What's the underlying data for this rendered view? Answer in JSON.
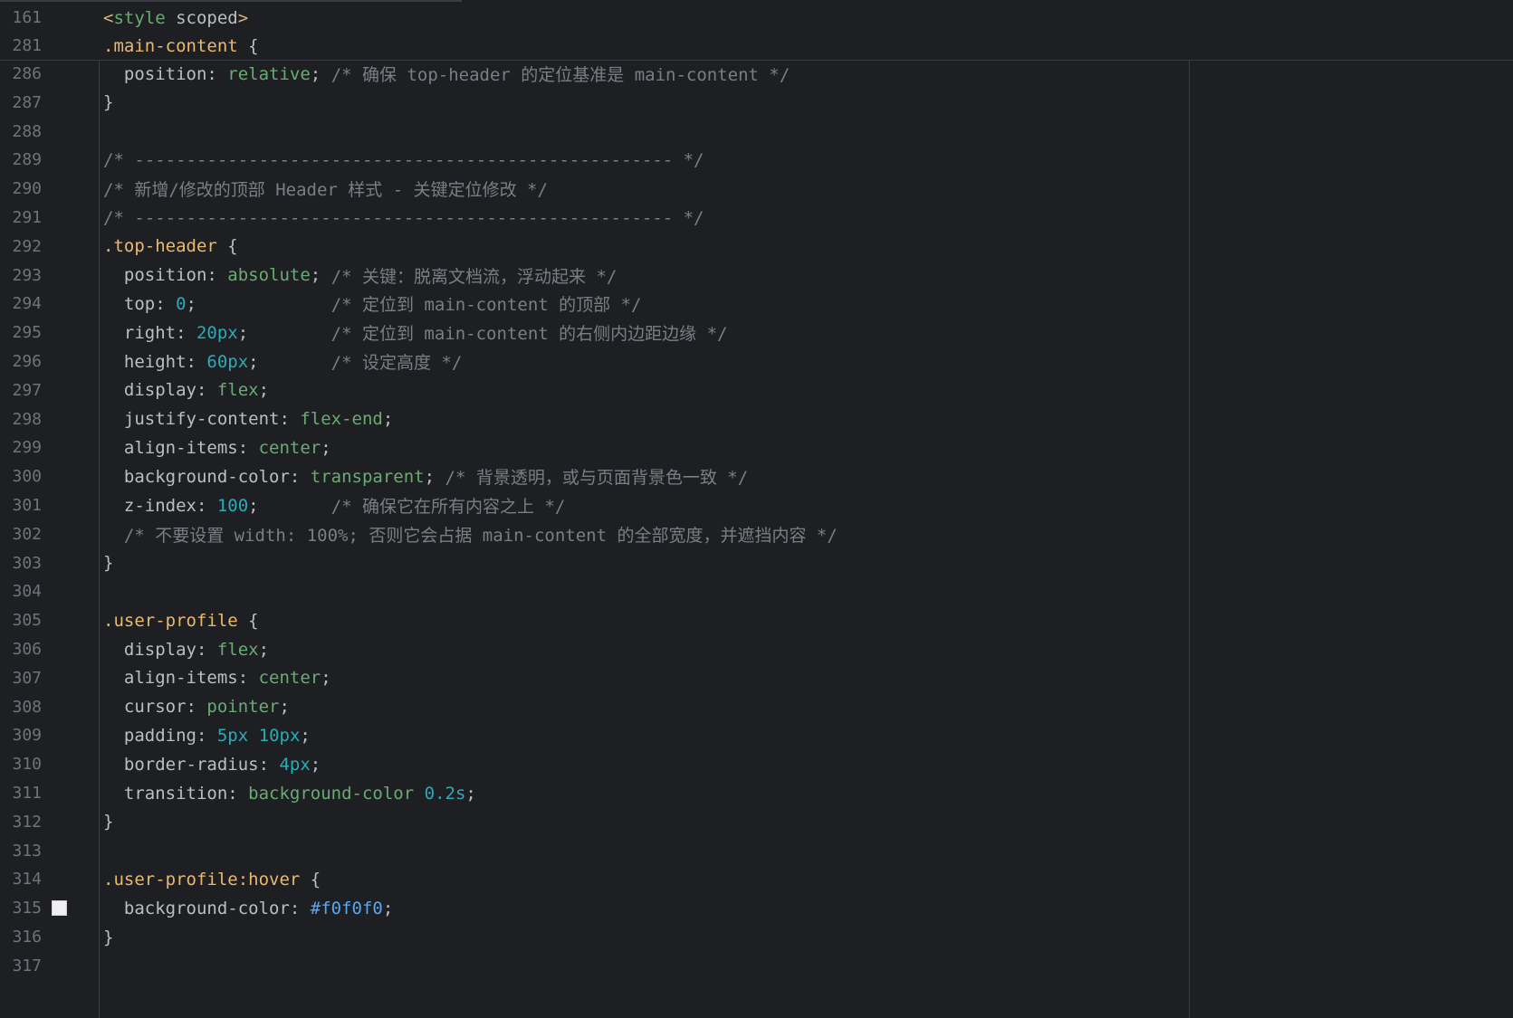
{
  "editor": {
    "language": "css",
    "colors": {
      "background": "#1e1f22",
      "line_number": "#6f737a",
      "property": "#bcbec4",
      "selector": "#e8ba71",
      "value_keyword": "#6aab73",
      "number": "#2aacb8",
      "comment": "#7a7e85",
      "hex_color": "#56a8f5"
    },
    "sticky_lines": [
      {
        "num": "161",
        "tokens": [
          {
            "t": "tag",
            "v": "<"
          },
          {
            "t": "tagname",
            "v": "style"
          },
          {
            "t": "plain",
            "v": " scoped"
          },
          {
            "t": "tag",
            "v": ">"
          }
        ]
      },
      {
        "num": "281",
        "tokens": [
          {
            "t": "sel",
            "v": ".main-content"
          },
          {
            "t": "plain",
            "v": " {"
          }
        ]
      }
    ],
    "lines": [
      {
        "num": "286",
        "tokens": [
          {
            "t": "plain",
            "v": "  position: "
          },
          {
            "t": "kw",
            "v": "relative"
          },
          {
            "t": "plain",
            "v": "; "
          },
          {
            "t": "com",
            "v": "/* 确保 top-header 的定位基准是 main-content */"
          }
        ]
      },
      {
        "num": "287",
        "tokens": [
          {
            "t": "plain",
            "v": "}"
          }
        ]
      },
      {
        "num": "288",
        "tokens": []
      },
      {
        "num": "289",
        "tokens": [
          {
            "t": "com",
            "v": "/* ---------------------------------------------------- */"
          }
        ]
      },
      {
        "num": "290",
        "tokens": [
          {
            "t": "com",
            "v": "/* 新增/修改的顶部 Header 样式 - 关键定位修改 */"
          }
        ]
      },
      {
        "num": "291",
        "tokens": [
          {
            "t": "com",
            "v": "/* ---------------------------------------------------- */"
          }
        ]
      },
      {
        "num": "292",
        "tokens": [
          {
            "t": "sel",
            "v": ".top-header"
          },
          {
            "t": "plain",
            "v": " {"
          }
        ]
      },
      {
        "num": "293",
        "tokens": [
          {
            "t": "plain",
            "v": "  position: "
          },
          {
            "t": "kw",
            "v": "absolute"
          },
          {
            "t": "plain",
            "v": "; "
          },
          {
            "t": "com",
            "v": "/* 关键：脱离文档流，浮动起来 */"
          }
        ]
      },
      {
        "num": "294",
        "tokens": [
          {
            "t": "plain",
            "v": "  top: "
          },
          {
            "t": "num",
            "v": "0"
          },
          {
            "t": "plain",
            "v": ";             "
          },
          {
            "t": "com",
            "v": "/* 定位到 main-content 的顶部 */"
          }
        ]
      },
      {
        "num": "295",
        "tokens": [
          {
            "t": "plain",
            "v": "  right: "
          },
          {
            "t": "num",
            "v": "20px"
          },
          {
            "t": "plain",
            "v": ";        "
          },
          {
            "t": "com",
            "v": "/* 定位到 main-content 的右侧内边距边缘 */"
          }
        ]
      },
      {
        "num": "296",
        "tokens": [
          {
            "t": "plain",
            "v": "  height: "
          },
          {
            "t": "num",
            "v": "60px"
          },
          {
            "t": "plain",
            "v": ";       "
          },
          {
            "t": "com",
            "v": "/* 设定高度 */"
          }
        ]
      },
      {
        "num": "297",
        "tokens": [
          {
            "t": "plain",
            "v": "  display: "
          },
          {
            "t": "kw",
            "v": "flex"
          },
          {
            "t": "plain",
            "v": ";"
          }
        ]
      },
      {
        "num": "298",
        "tokens": [
          {
            "t": "plain",
            "v": "  justify-content: "
          },
          {
            "t": "kw",
            "v": "flex-end"
          },
          {
            "t": "plain",
            "v": ";"
          }
        ]
      },
      {
        "num": "299",
        "tokens": [
          {
            "t": "plain",
            "v": "  align-items: "
          },
          {
            "t": "kw",
            "v": "center"
          },
          {
            "t": "plain",
            "v": ";"
          }
        ]
      },
      {
        "num": "300",
        "tokens": [
          {
            "t": "plain",
            "v": "  background-color: "
          },
          {
            "t": "kw",
            "v": "transparent"
          },
          {
            "t": "plain",
            "v": "; "
          },
          {
            "t": "com",
            "v": "/* 背景透明，或与页面背景色一致 */"
          }
        ]
      },
      {
        "num": "301",
        "tokens": [
          {
            "t": "plain",
            "v": "  z-index: "
          },
          {
            "t": "num",
            "v": "100"
          },
          {
            "t": "plain",
            "v": ";       "
          },
          {
            "t": "com",
            "v": "/* 确保它在所有内容之上 */"
          }
        ]
      },
      {
        "num": "302",
        "tokens": [
          {
            "t": "com",
            "v": "  /* 不要设置 width: 100%; 否则它会占据 main-content 的全部宽度，并遮挡内容 */"
          }
        ]
      },
      {
        "num": "303",
        "tokens": [
          {
            "t": "plain",
            "v": "}"
          }
        ]
      },
      {
        "num": "304",
        "tokens": []
      },
      {
        "num": "305",
        "tokens": [
          {
            "t": "sel",
            "v": ".user-profile"
          },
          {
            "t": "plain",
            "v": " {"
          }
        ]
      },
      {
        "num": "306",
        "tokens": [
          {
            "t": "plain",
            "v": "  display: "
          },
          {
            "t": "kw",
            "v": "flex"
          },
          {
            "t": "plain",
            "v": ";"
          }
        ]
      },
      {
        "num": "307",
        "tokens": [
          {
            "t": "plain",
            "v": "  align-items: "
          },
          {
            "t": "kw",
            "v": "center"
          },
          {
            "t": "plain",
            "v": ";"
          }
        ]
      },
      {
        "num": "308",
        "tokens": [
          {
            "t": "plain",
            "v": "  cursor: "
          },
          {
            "t": "kw",
            "v": "pointer"
          },
          {
            "t": "plain",
            "v": ";"
          }
        ]
      },
      {
        "num": "309",
        "tokens": [
          {
            "t": "plain",
            "v": "  padding: "
          },
          {
            "t": "num",
            "v": "5px"
          },
          {
            "t": "plain",
            "v": " "
          },
          {
            "t": "num",
            "v": "10px"
          },
          {
            "t": "plain",
            "v": ";"
          }
        ]
      },
      {
        "num": "310",
        "tokens": [
          {
            "t": "plain",
            "v": "  border-radius: "
          },
          {
            "t": "num",
            "v": "4px"
          },
          {
            "t": "plain",
            "v": ";"
          }
        ]
      },
      {
        "num": "311",
        "tokens": [
          {
            "t": "plain",
            "v": "  transition: "
          },
          {
            "t": "kw",
            "v": "background-color"
          },
          {
            "t": "plain",
            "v": " "
          },
          {
            "t": "num",
            "v": "0.2s"
          },
          {
            "t": "plain",
            "v": ";"
          }
        ]
      },
      {
        "num": "312",
        "tokens": [
          {
            "t": "plain",
            "v": "}"
          }
        ]
      },
      {
        "num": "313",
        "tokens": []
      },
      {
        "num": "314",
        "tokens": [
          {
            "t": "sel",
            "v": ".user-profile"
          },
          {
            "t": "ps",
            "v": ":hover"
          },
          {
            "t": "plain",
            "v": " {"
          }
        ]
      },
      {
        "num": "315",
        "swatch": "#f0f0f0",
        "tokens": [
          {
            "t": "plain",
            "v": "  background-color: "
          },
          {
            "t": "hex",
            "v": "#f0f0f0"
          },
          {
            "t": "plain",
            "v": ";"
          }
        ]
      },
      {
        "num": "316",
        "tokens": [
          {
            "t": "plain",
            "v": "}"
          }
        ]
      },
      {
        "num": "317",
        "tokens": []
      }
    ]
  }
}
